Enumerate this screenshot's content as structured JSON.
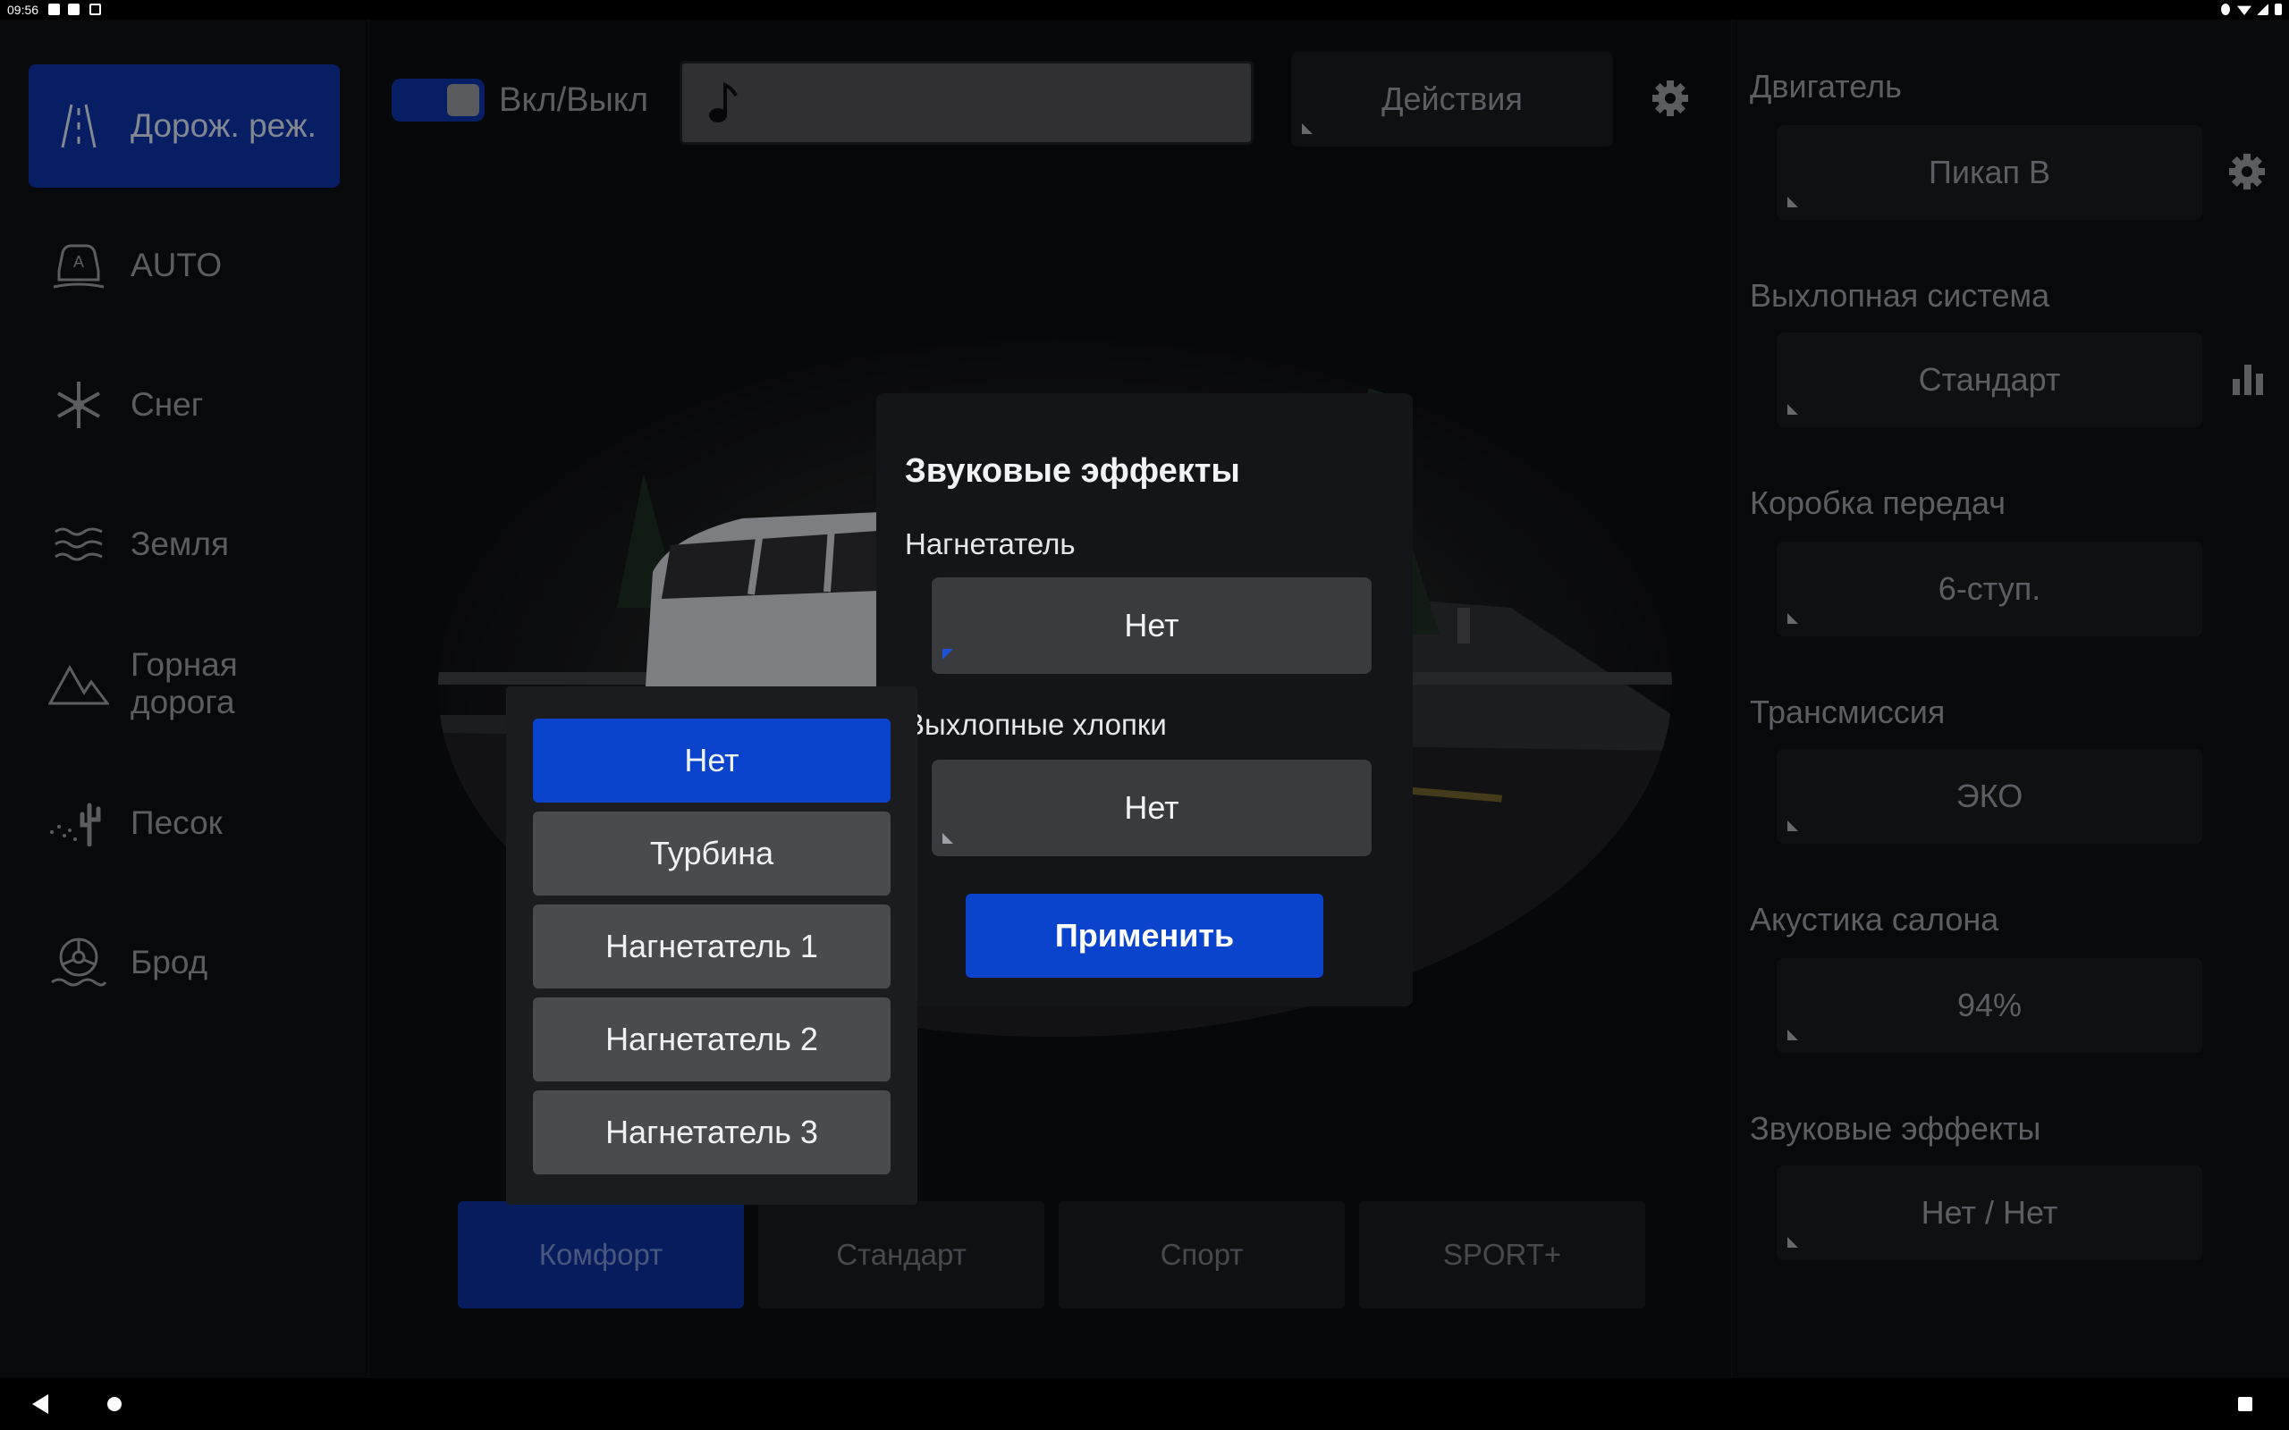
{
  "status_bar": {
    "time": "09:56"
  },
  "sidebar": {
    "items": [
      {
        "label": "Дорож. реж.",
        "icon": "road-icon",
        "active": true
      },
      {
        "label": "AUTO",
        "icon": "auto-mode-icon",
        "active": false
      },
      {
        "label": "Снег",
        "icon": "snowflake-icon",
        "active": false
      },
      {
        "label": "Земля",
        "icon": "waves-icon",
        "active": false
      },
      {
        "label": "Горная\nдорога",
        "icon": "mountain-icon",
        "active": false
      },
      {
        "label": "Песок",
        "icon": "cactus-icon",
        "active": false
      },
      {
        "label": "Брод",
        "icon": "wheel-water-icon",
        "active": false
      }
    ]
  },
  "topbar": {
    "toggle_label": "Вкл/Выкл",
    "toggle_on": true,
    "music_icon": "music-note-icon",
    "actions_label": "Действия",
    "settings_icon": "gear-icon"
  },
  "modes": [
    {
      "label": "Комфорт",
      "active": true
    },
    {
      "label": "Стандарт",
      "active": false
    },
    {
      "label": "Спорт",
      "active": false
    },
    {
      "label": "SPORT+",
      "active": false
    }
  ],
  "right_panel": {
    "sections": [
      {
        "label": "Двигатель",
        "value": "Пикап В",
        "side_icon": "gear-icon"
      },
      {
        "label": "Выхлопная система",
        "value": "Стандарт",
        "side_icon": "bar-chart-icon"
      },
      {
        "label": "Коробка передач",
        "value": "6-ступ."
      },
      {
        "label": "Трансмиссия",
        "value": "ЭКО"
      },
      {
        "label": "Акустика салона",
        "value": "94%"
      },
      {
        "label": "Звуковые эффекты",
        "value": "Нет / Нет"
      }
    ]
  },
  "dialog": {
    "title": "Звуковые эффекты",
    "supercharger_label": "Нагнетатель",
    "supercharger_value": "Нет",
    "backfire_label": "Выхлопные хлопки",
    "backfire_value": "Нет",
    "apply_label": "Применить"
  },
  "dropdown": {
    "options": [
      "Нет",
      "Турбина",
      "Нагнетатель 1",
      "Нагнетатель 2",
      "Нагнетатель 3"
    ],
    "selected": "Нет"
  },
  "colors": {
    "accent": "#0a43cc",
    "active_nav": "#0b2f9a",
    "panel": "#18191c"
  }
}
